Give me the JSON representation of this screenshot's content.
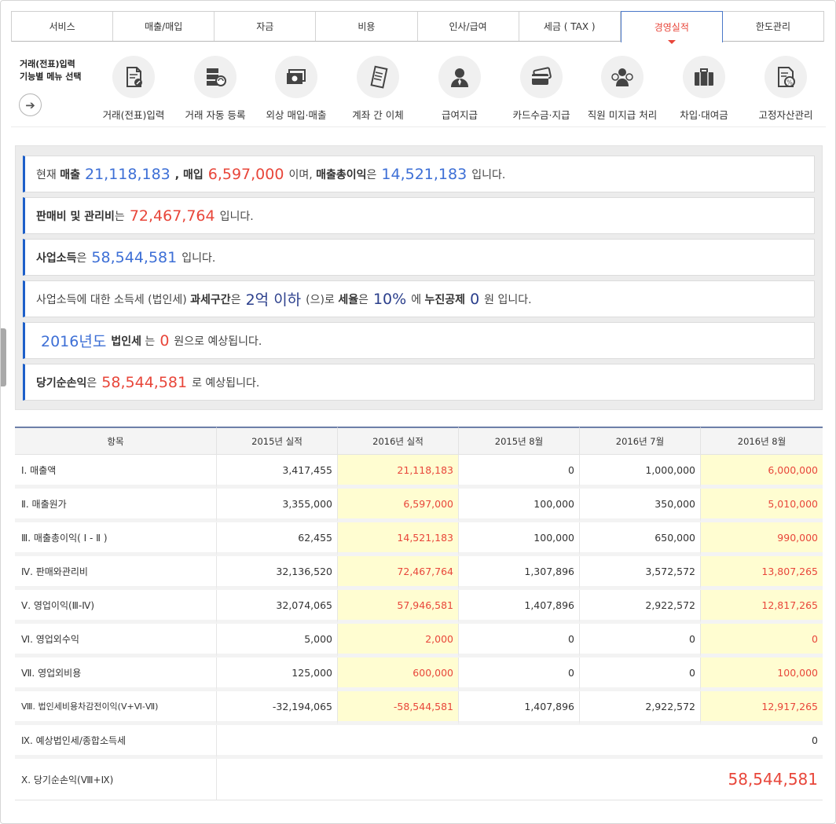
{
  "tabs": [
    {
      "label": "서비스",
      "active": false
    },
    {
      "label": "매출/매입",
      "active": false
    },
    {
      "label": "자금",
      "active": false
    },
    {
      "label": "비용",
      "active": false
    },
    {
      "label": "인사/급여",
      "active": false
    },
    {
      "label": "세금 ( TAX )",
      "active": false
    },
    {
      "label": "경영실적",
      "active": true
    },
    {
      "label": "한도관리",
      "active": false
    }
  ],
  "menu": {
    "intro_line1": "거래(전표)입력",
    "intro_line2": "기능별 메뉴 선택",
    "items": [
      {
        "label": "거래(전표)입력",
        "icon": "document-edit-icon"
      },
      {
        "label": "거래 자동 등록",
        "icon": "server-sync-icon"
      },
      {
        "label": "외상 매입·매출",
        "icon": "cash-icon"
      },
      {
        "label": "계좌 간 이체",
        "icon": "receipt-icon"
      },
      {
        "label": "급여지급",
        "icon": "person-icon"
      },
      {
        "label": "카드수금·지급",
        "icon": "credit-card-icon"
      },
      {
        "label": "직원 미지급 처리",
        "icon": "employee-money-icon"
      },
      {
        "label": "차입·대여금",
        "icon": "briefcase-icon"
      },
      {
        "label": "고정자산관리",
        "icon": "asset-document-icon"
      }
    ]
  },
  "summary": {
    "row1": {
      "t1": "현재",
      "t2": "매출",
      "v1": "21,118,183",
      "t3": ", 매입",
      "v2": "6,597,000",
      "t4": "이며,",
      "t5": "매출총이익",
      "t6": "은",
      "v3": "14,521,183",
      "t7": "입니다."
    },
    "row2": {
      "t1": "판매비 및 관리비",
      "t2": "는",
      "v1": "72,467,764",
      "t3": "입니다."
    },
    "row3": {
      "t1": "사업소득",
      "t2": "은",
      "v1": "58,544,581",
      "t3": "입니다."
    },
    "row4": {
      "t1": "사업소득에 대한 소득세 (법인세)",
      "t2": "과세구간",
      "t3": "은",
      "v1": "2억 이하",
      "t4": "(으)로",
      "t5": "세율",
      "t6": "은",
      "v2": "10%",
      "t7": "에",
      "t8": "누진공제",
      "v3": "0",
      "t9": "원 입니다."
    },
    "row5": {
      "v1": "2016년도",
      "t1": "법인세",
      "t2": "는",
      "v2": "0",
      "t3": "원으로 예상됩니다."
    },
    "row6": {
      "t1": "당기순손익",
      "t2": "은",
      "v1": "58,544,581",
      "t3": "로 예상됩니다."
    }
  },
  "table": {
    "headers": [
      "항목",
      "2015년 실적",
      "2016년 실적",
      "2015년 8월",
      "2016년 7월",
      "2016년 8월"
    ],
    "rows": [
      [
        "Ⅰ. 매출액",
        "3,417,455",
        "21,118,183",
        "0",
        "1,000,000",
        "6,000,000"
      ],
      [
        "Ⅱ. 매출원가",
        "3,355,000",
        "6,597,000",
        "100,000",
        "350,000",
        "5,010,000"
      ],
      [
        "Ⅲ. 매출총이익( Ⅰ - Ⅱ )",
        "62,455",
        "14,521,183",
        "100,000",
        "650,000",
        "990,000"
      ],
      [
        "Ⅳ. 판매와관리비",
        "32,136,520",
        "72,467,764",
        "1,307,896",
        "3,572,572",
        "13,807,265"
      ],
      [
        "Ⅴ. 영업이익(Ⅲ-Ⅳ)",
        "32,074,065",
        "57,946,581",
        "1,407,896",
        "2,922,572",
        "12,817,265"
      ],
      [
        "Ⅵ. 영업외수익",
        "5,000",
        "2,000",
        "0",
        "0",
        "0"
      ],
      [
        "Ⅶ. 영업외비용",
        "125,000",
        "600,000",
        "0",
        "0",
        "100,000"
      ],
      [
        "Ⅷ. 법인세비용차감전이익(Ⅴ+Ⅵ-Ⅶ)",
        "-32,194,065",
        "-58,544,581",
        "1,407,896",
        "2,922,572",
        "12,917,265"
      ]
    ],
    "row9": {
      "label": "Ⅸ. 예상법인세/종합소득세",
      "value": "0"
    },
    "row10": {
      "label": "Ⅹ. 당기순손익(Ⅷ+Ⅸ)",
      "value": "58,544,581"
    }
  }
}
